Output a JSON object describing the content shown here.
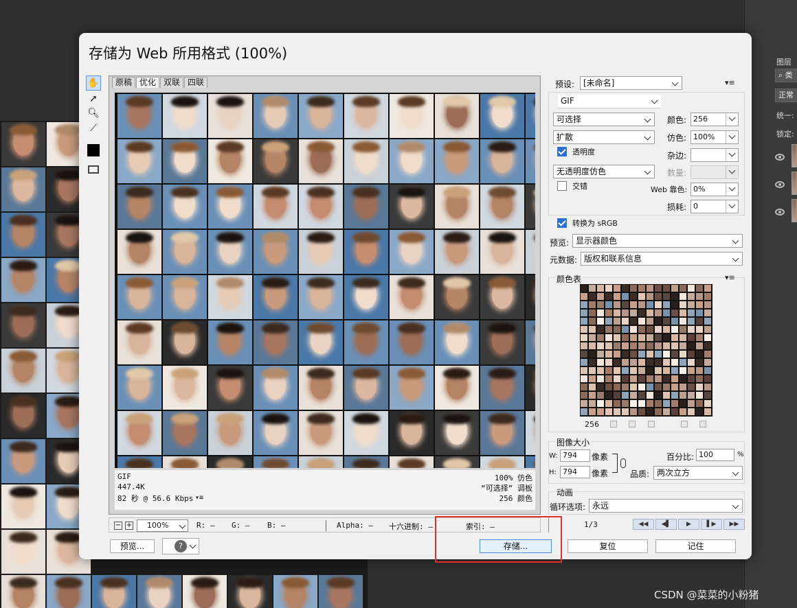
{
  "dialog": {
    "title": "存储为 Web 所用格式 (100%)"
  },
  "tabs": [
    "原稿",
    "优化",
    "双联",
    "四联"
  ],
  "preview_info": {
    "format": "GIF",
    "size": "447.4K",
    "time": "82 秒 @ 56.6 Kbps",
    "dither": "100% 仿色",
    "palette": "“可选择” 调板",
    "colors": "256 颜色"
  },
  "statusbar": {
    "zoom": "100%",
    "r": "R: —",
    "g": "G: —",
    "b": "B: —",
    "alpha": "Alpha: —",
    "hex": "十六进制: —",
    "index": "索引: —",
    "minus": "−",
    "plus": "+"
  },
  "frames": {
    "counter": "1/3",
    "nav": [
      "◀◀",
      "◀▌",
      "▶",
      "▌▶",
      "▶▶"
    ]
  },
  "buttons": {
    "preview": "预览...",
    "save": "存储...",
    "reset": "复位",
    "remember": "记住"
  },
  "settings": {
    "preset_label": "预设:",
    "preset_value": "[未命名]",
    "format": "GIF",
    "reduction": "可选择",
    "dither_algo": "扩散",
    "transparency_label": "透明度",
    "transparency_dither": "无透明度仿色",
    "interlaced_label": "交错",
    "colors_label": "颜色:",
    "colors_value": "256",
    "dither_label": "仿色:",
    "dither_value": "100%",
    "matte_label": "杂边:",
    "matte_value": "",
    "amount_label": "数量:",
    "amount_value": "",
    "websnap_label": "Web 靠色:",
    "websnap_value": "0%",
    "lossy_label": "损耗:",
    "lossy_value": "0",
    "srgb_label": "转换为 sRGB",
    "preview_label": "预览:",
    "preview_value": "显示器颜色",
    "metadata_label": "元数据:",
    "metadata_value": "版权和联系信息",
    "color_table_label": "颜色表",
    "color_count": "256"
  },
  "image_size": {
    "label": "图像大小",
    "w_label": "W:",
    "w_value": "794",
    "h_label": "H:",
    "h_value": "794",
    "unit": "像素",
    "percent_label": "百分比:",
    "percent_value": "100",
    "percent_sign": "%",
    "quality_label": "品质:",
    "quality_value": "两次立方"
  },
  "animation": {
    "label": "动画",
    "loop_label": "循环选项:",
    "loop_value": "永远"
  },
  "photoshop_panel": {
    "layers_label": "图层",
    "kind_label": "类",
    "blend_mode": "正常",
    "unify_label": "统一:",
    "lock_label": "锁定:"
  },
  "watermark": "CSDN @菜菜的小粉猪"
}
